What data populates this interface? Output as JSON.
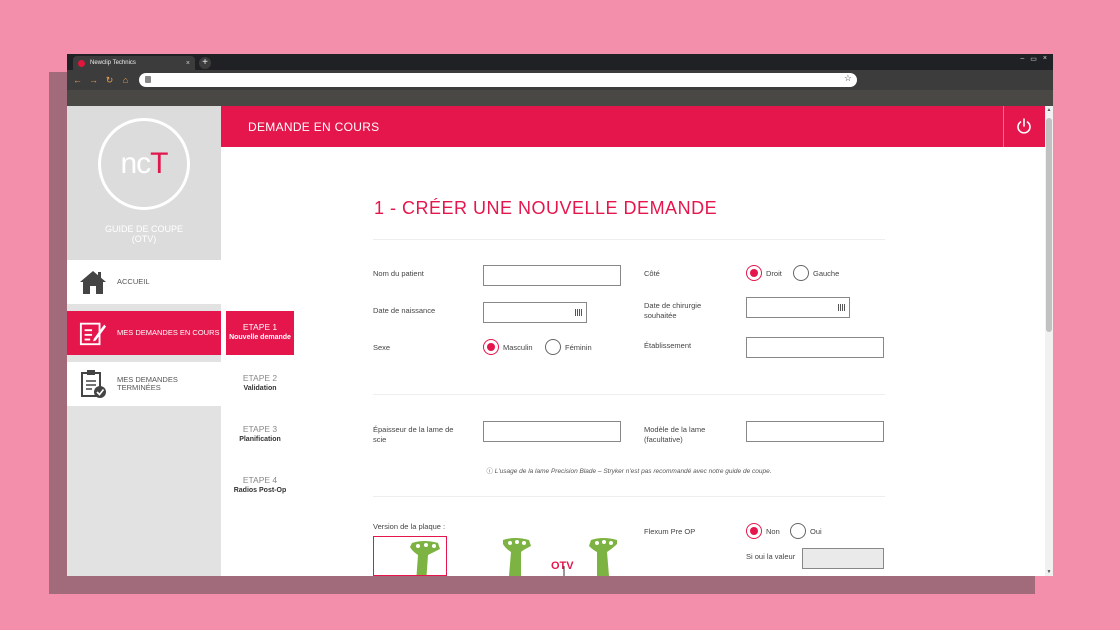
{
  "browser": {
    "tab_title": "Newclip Technics",
    "tab_close": "×",
    "new_tab": "+",
    "window_controls": [
      "–",
      "▭",
      "×"
    ]
  },
  "sidebar": {
    "logo_text_left": "nc",
    "logo_text_right": "T",
    "logo_caption_line1": "GUIDE DE COUPE",
    "logo_caption_line2": "(OTV)",
    "items": [
      {
        "label": "ACCUEIL",
        "icon": "home-icon"
      },
      {
        "label": "MES DEMANDES EN COURS",
        "icon": "form-edit-icon"
      },
      {
        "label": "MES DEMANDES TERMINÉES",
        "icon": "clipboard-check-icon"
      }
    ]
  },
  "steps": [
    {
      "num": "ETAPE 1",
      "name": "Nouvelle demande"
    },
    {
      "num": "ETAPE 2",
      "name": "Validation"
    },
    {
      "num": "ETAPE 3",
      "name": "Planification"
    },
    {
      "num": "ETAPE 4",
      "name": "Radios Post-Op"
    }
  ],
  "header": {
    "title": "DEMANDE EN COURS"
  },
  "form": {
    "heading": "1 - CRÉER UNE NOUVELLE DEMANDE",
    "patient_name_label": "Nom du patient",
    "birth_date_label": "Date de naissance",
    "sex_label": "Sexe",
    "sex_options": [
      "Masculin",
      "Féminin"
    ],
    "side_label": "Côté",
    "side_options": [
      "Droit",
      "Gauche"
    ],
    "surgery_date_label_1": "Date de chirurgie",
    "surgery_date_label_2": "souhaitée",
    "establishment_label": "Établissement",
    "blade_thickness_label_1": "Épaisseur de la lame de",
    "blade_thickness_label_2": "scie",
    "blade_model_label_1": "Modèle de la lame",
    "blade_model_label_2": "(facultative)",
    "note": "L'usage de la lame Precision Blade – Stryker n'est pas recommandé avec notre guide de coupe.",
    "plate_version_label": "Version de la plaque :",
    "otv_label": "OTV",
    "flexum_label": "Flexum Pre OP",
    "flexum_options": [
      "Non",
      "Oui"
    ],
    "flexum_value_label": "Si oui la valeur"
  },
  "colors": {
    "brand": "#e5164c",
    "sidebar_bg": "#e2e2e2",
    "background": "#f48fab"
  }
}
